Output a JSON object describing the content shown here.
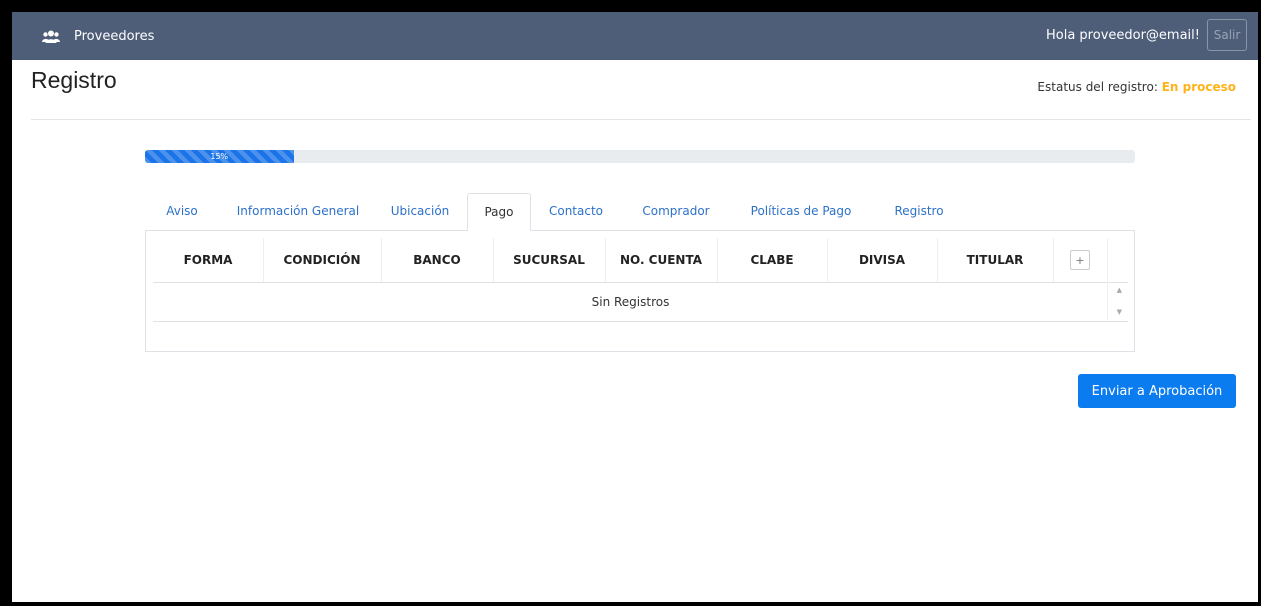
{
  "navbar": {
    "brand_icon": "users-icon",
    "brand": "Proveedores",
    "greeting": "Hola proveedor@email!",
    "logout_label": "Salir"
  },
  "page": {
    "title": "Registro",
    "status_label": "Estatus del registro:",
    "status_value": "En proceso",
    "status_color": "#ffb31a"
  },
  "progress": {
    "value_percent": 15,
    "label": "15%"
  },
  "tabs": [
    {
      "label": "Aviso",
      "active": false
    },
    {
      "label": "Información General",
      "active": false
    },
    {
      "label": "Ubicación",
      "active": false
    },
    {
      "label": "Pago",
      "active": true
    },
    {
      "label": "Contacto",
      "active": false
    },
    {
      "label": "Comprador",
      "active": false
    },
    {
      "label": "Políticas de Pago",
      "active": false
    },
    {
      "label": "Registro",
      "active": false
    }
  ],
  "table": {
    "columns": [
      "FORMA",
      "CONDICIÓN",
      "BANCO",
      "SUCURSAL",
      "NO. CUENTA",
      "CLABE",
      "DIVISA",
      "TITULAR"
    ],
    "add_label": "+",
    "empty_message": "Sin Registros"
  },
  "actions": {
    "submit_label": "Enviar a Aprobación",
    "accent_color": "#0b7cf0"
  }
}
